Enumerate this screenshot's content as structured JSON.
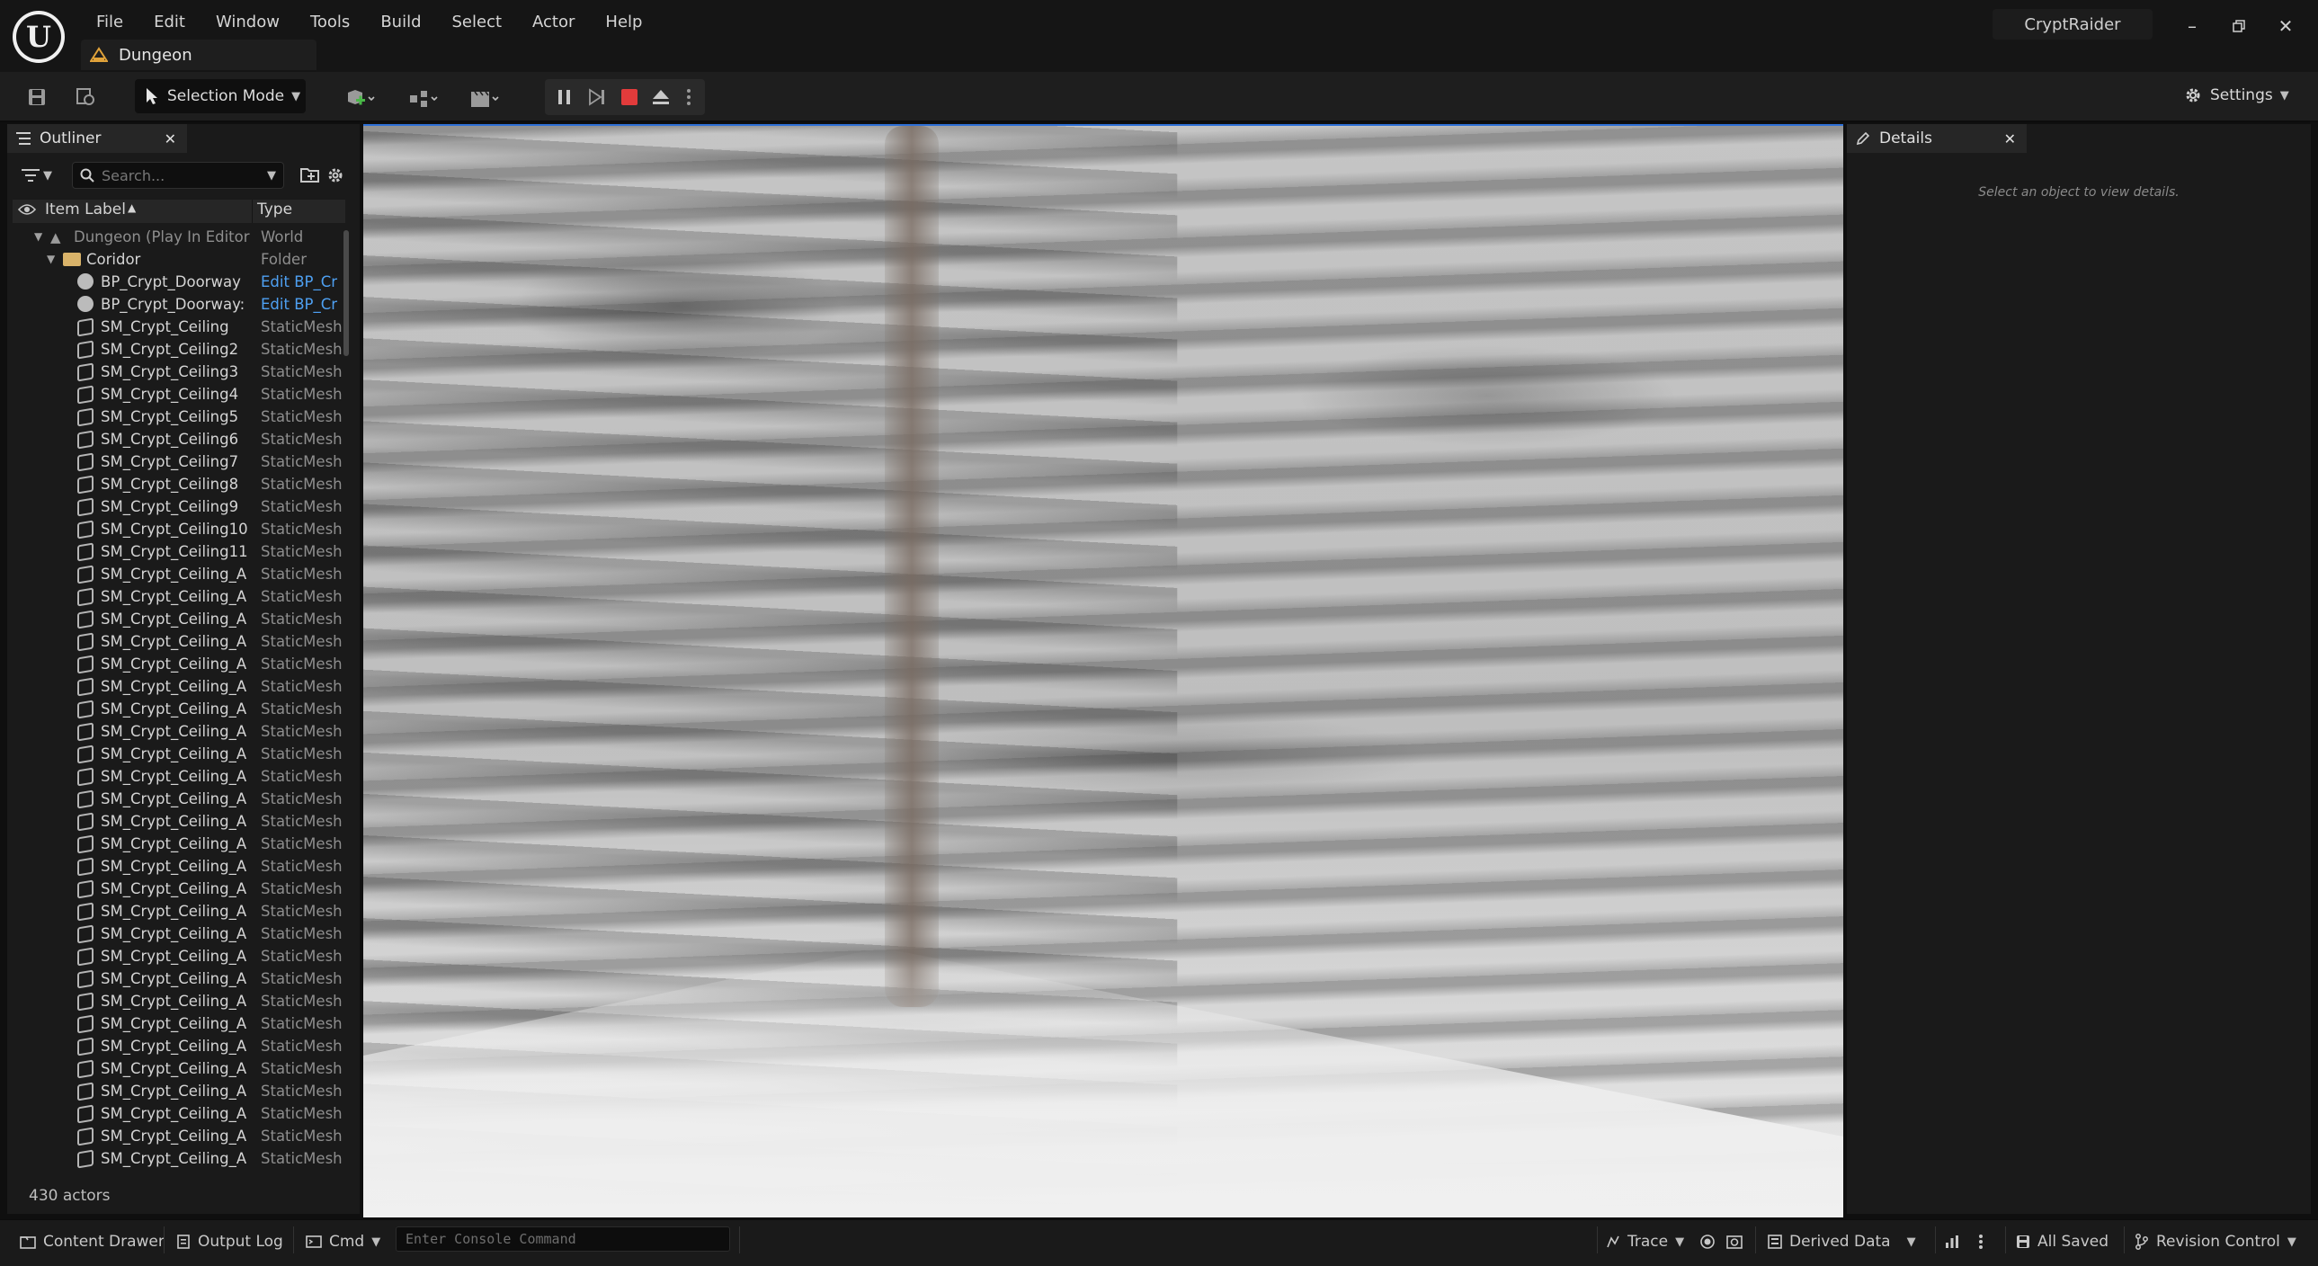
{
  "menu": [
    "File",
    "Edit",
    "Window",
    "Tools",
    "Build",
    "Select",
    "Actor",
    "Help"
  ],
  "level_tab": "Dungeon",
  "project_name": "CryptRaider",
  "toolbar": {
    "selection_mode": "Selection Mode",
    "settings": "Settings"
  },
  "outliner": {
    "tab_label": "Outliner",
    "search_placeholder": "Search...",
    "col_label": "Item Label",
    "col_type": "Type",
    "rows": [
      {
        "label": "Dungeon (Play In Editor",
        "type": "World",
        "kind": "world",
        "depth": 0
      },
      {
        "label": "Coridor",
        "type": "Folder",
        "kind": "folder",
        "depth": 1
      },
      {
        "label": "BP_Crypt_Doorway",
        "type": "Edit BP_Cr",
        "kind": "bp",
        "depth": 2
      },
      {
        "label": "BP_Crypt_Doorway:",
        "type": "Edit BP_Cr",
        "kind": "bp",
        "depth": 2
      },
      {
        "label": "SM_Crypt_Ceiling",
        "type": "StaticMesh",
        "kind": "mesh",
        "depth": 2
      },
      {
        "label": "SM_Crypt_Ceiling2",
        "type": "StaticMesh",
        "kind": "mesh",
        "depth": 2
      },
      {
        "label": "SM_Crypt_Ceiling3",
        "type": "StaticMesh",
        "kind": "mesh",
        "depth": 2
      },
      {
        "label": "SM_Crypt_Ceiling4",
        "type": "StaticMesh",
        "kind": "mesh",
        "depth": 2
      },
      {
        "label": "SM_Crypt_Ceiling5",
        "type": "StaticMesh",
        "kind": "mesh",
        "depth": 2
      },
      {
        "label": "SM_Crypt_Ceiling6",
        "type": "StaticMesh",
        "kind": "mesh",
        "depth": 2
      },
      {
        "label": "SM_Crypt_Ceiling7",
        "type": "StaticMesh",
        "kind": "mesh",
        "depth": 2
      },
      {
        "label": "SM_Crypt_Ceiling8",
        "type": "StaticMesh",
        "kind": "mesh",
        "depth": 2
      },
      {
        "label": "SM_Crypt_Ceiling9",
        "type": "StaticMesh",
        "kind": "mesh",
        "depth": 2
      },
      {
        "label": "SM_Crypt_Ceiling10",
        "type": "StaticMesh",
        "kind": "mesh",
        "depth": 2
      },
      {
        "label": "SM_Crypt_Ceiling11",
        "type": "StaticMesh",
        "kind": "mesh",
        "depth": 2
      },
      {
        "label": "SM_Crypt_Ceiling_A",
        "type": "StaticMesh",
        "kind": "mesh",
        "depth": 2
      },
      {
        "label": "SM_Crypt_Ceiling_A",
        "type": "StaticMesh",
        "kind": "mesh",
        "depth": 2
      },
      {
        "label": "SM_Crypt_Ceiling_A",
        "type": "StaticMesh",
        "kind": "mesh",
        "depth": 2
      },
      {
        "label": "SM_Crypt_Ceiling_A",
        "type": "StaticMesh",
        "kind": "mesh",
        "depth": 2
      },
      {
        "label": "SM_Crypt_Ceiling_A",
        "type": "StaticMesh",
        "kind": "mesh",
        "depth": 2
      },
      {
        "label": "SM_Crypt_Ceiling_A",
        "type": "StaticMesh",
        "kind": "mesh",
        "depth": 2
      },
      {
        "label": "SM_Crypt_Ceiling_A",
        "type": "StaticMesh",
        "kind": "mesh",
        "depth": 2
      },
      {
        "label": "SM_Crypt_Ceiling_A",
        "type": "StaticMesh",
        "kind": "mesh",
        "depth": 2
      },
      {
        "label": "SM_Crypt_Ceiling_A",
        "type": "StaticMesh",
        "kind": "mesh",
        "depth": 2
      },
      {
        "label": "SM_Crypt_Ceiling_A",
        "type": "StaticMesh",
        "kind": "mesh",
        "depth": 2
      },
      {
        "label": "SM_Crypt_Ceiling_A",
        "type": "StaticMesh",
        "kind": "mesh",
        "depth": 2
      },
      {
        "label": "SM_Crypt_Ceiling_A",
        "type": "StaticMesh",
        "kind": "mesh",
        "depth": 2
      },
      {
        "label": "SM_Crypt_Ceiling_A",
        "type": "StaticMesh",
        "kind": "mesh",
        "depth": 2
      },
      {
        "label": "SM_Crypt_Ceiling_A",
        "type": "StaticMesh",
        "kind": "mesh",
        "depth": 2
      },
      {
        "label": "SM_Crypt_Ceiling_A",
        "type": "StaticMesh",
        "kind": "mesh",
        "depth": 2
      },
      {
        "label": "SM_Crypt_Ceiling_A",
        "type": "StaticMesh",
        "kind": "mesh",
        "depth": 2
      },
      {
        "label": "SM_Crypt_Ceiling_A",
        "type": "StaticMesh",
        "kind": "mesh",
        "depth": 2
      },
      {
        "label": "SM_Crypt_Ceiling_A",
        "type": "StaticMesh",
        "kind": "mesh",
        "depth": 2
      },
      {
        "label": "SM_Crypt_Ceiling_A",
        "type": "StaticMesh",
        "kind": "mesh",
        "depth": 2
      },
      {
        "label": "SM_Crypt_Ceiling_A",
        "type": "StaticMesh",
        "kind": "mesh",
        "depth": 2
      },
      {
        "label": "SM_Crypt_Ceiling_A",
        "type": "StaticMesh",
        "kind": "mesh",
        "depth": 2
      },
      {
        "label": "SM_Crypt_Ceiling_A",
        "type": "StaticMesh",
        "kind": "mesh",
        "depth": 2
      },
      {
        "label": "SM_Crypt_Ceiling_A",
        "type": "StaticMesh",
        "kind": "mesh",
        "depth": 2
      },
      {
        "label": "SM_Crypt_Ceiling_A",
        "type": "StaticMesh",
        "kind": "mesh",
        "depth": 2
      },
      {
        "label": "SM_Crypt_Ceiling_A",
        "type": "StaticMesh",
        "kind": "mesh",
        "depth": 2
      },
      {
        "label": "SM_Crypt_Ceiling_A",
        "type": "StaticMesh",
        "kind": "mesh",
        "depth": 2
      },
      {
        "label": "SM_Crypt_Ceiling_A",
        "type": "StaticMesh",
        "kind": "mesh",
        "depth": 2
      }
    ],
    "actor_count": "430 actors"
  },
  "details": {
    "tab_label": "Details",
    "empty_text": "Select an object to view details."
  },
  "statusbar": {
    "content_drawer": "Content Drawer",
    "output_log": "Output Log",
    "cmd": "Cmd",
    "console_placeholder": "Enter Console Command",
    "trace": "Trace",
    "derived_data": "Derived Data",
    "all_saved": "All Saved",
    "revision_control": "Revision Control"
  },
  "colors": {
    "accent": "#2d6fd6",
    "link": "#4ea0f2",
    "stop": "#e23b3b",
    "add": "#49b847",
    "folder": "#d9b36a"
  }
}
